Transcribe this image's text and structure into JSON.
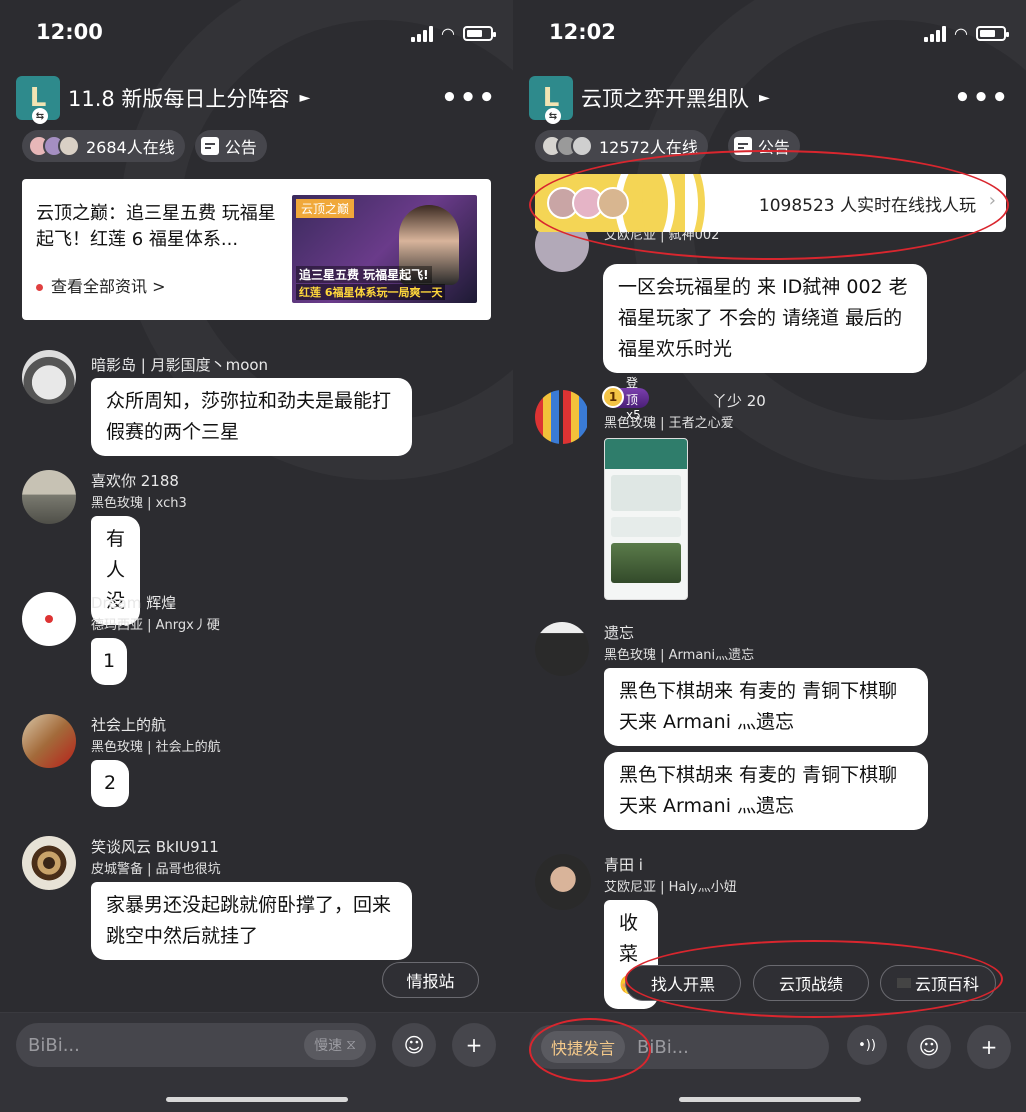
{
  "left": {
    "status": {
      "time": "12:00"
    },
    "header": {
      "title": "11.8 新版每日上分阵容",
      "arrow": "►",
      "more": "•••",
      "logo_letter": "L"
    },
    "online": "2684人在线",
    "notice": "公告",
    "news": {
      "headline": "云顶之巅：追三星五费 玩福星起飞！红莲 6 福星体系...",
      "link": "查看全部资讯 >",
      "thumb_tag": "云顶之巅",
      "thumb_cap1": "追三星五费 玩福星起飞!",
      "thumb_cap2": "红莲 6福星体系玩一局爽一天"
    },
    "messages": [
      {
        "name": "暗影岛 | 月影国度丶moon",
        "text": "众所周知，莎弥拉和劲夫是最能打假赛的两个三星"
      },
      {
        "name": "喜欢你 2188",
        "sub": "黑色玫瑰 | xch3",
        "text": "有人没"
      },
      {
        "name": "Dream 辉煌",
        "sub": "德玛西亚 | Anrgx丿硬",
        "text": "1"
      },
      {
        "name": "社会上的航",
        "sub": "黑色玫瑰 | 社会上的航",
        "text": "2"
      },
      {
        "name": "笑谈风云 BkIU911",
        "sub": "皮城警备 | 品哥也很坑",
        "text": "家暴男还没起跳就俯卧撑了，回来跳空中然后就挂了"
      }
    ],
    "info_button": "情报站",
    "input": {
      "placeholder": "BiBi...",
      "slow": "慢速",
      "slow_icon": "⧖"
    },
    "icons": {
      "emoji": "☺",
      "plus": "+"
    }
  },
  "right": {
    "status": {
      "time": "12:02"
    },
    "header": {
      "title": "云顶之弈开黑组队",
      "arrow": "►",
      "more": "•••",
      "logo_letter": "L"
    },
    "online": "12572人在线",
    "notice": "公告",
    "banner": {
      "text": "1098523 人实时在线找人玩",
      "chev": "›"
    },
    "cut_name": "艾欧尼亚 | 弑神002",
    "messages": [
      {
        "text": "一区会玩福星的 来 ID弑神 002 老福星玩家了 不会的 请绕道 最后的福星欢乐时光"
      },
      {
        "badge_num": "1",
        "badge_text": "登顶 x5",
        "name": "丫少 20",
        "sub": "黑色玫瑰 | 王者之心爱"
      },
      {
        "name": "遗忘",
        "sub": "黑色玫瑰 | Armani灬遗忘",
        "text": "黑色下棋胡来 有麦的 青铜下棋聊天来 Armani 灬遗忘",
        "text2": "黑色下棋胡来 有麦的 青铜下棋聊天来 Armani 灬遗忘"
      },
      {
        "name": "青田 i",
        "sub": "艾欧尼亚 | Haly灬小妞",
        "text": "收菜 🤭"
      }
    ],
    "quick": [
      "找人开黑",
      "云顶战绩",
      "云顶百科"
    ],
    "input": {
      "quick_speak": "快捷发言",
      "placeholder": "BiBi..."
    },
    "icons": {
      "voice": "•))",
      "emoji": "☺",
      "plus": "+"
    }
  },
  "colors": {
    "bg": "#2c2c30",
    "bubble": "#ffffff",
    "annotation_red": "#d9262e",
    "banner_yellow": "#f4d555"
  }
}
